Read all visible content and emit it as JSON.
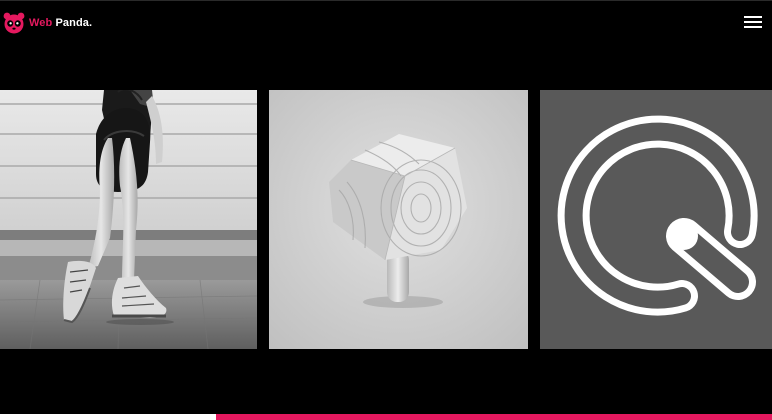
{
  "brand": {
    "name_part1": "Web",
    "name_part2": "Panda.",
    "logo_icon": "panda-icon",
    "accent_color": "#e5195f"
  },
  "header": {
    "menu_icon": "hamburger-menu-icon"
  },
  "gallery": {
    "items": [
      {
        "name": "portfolio-card-fashion",
        "description_icon": "photo"
      },
      {
        "name": "portfolio-card-wooden-object",
        "description_icon": "photo"
      },
      {
        "name": "portfolio-card-q-logo",
        "description_icon": "logo"
      }
    ]
  },
  "progress": {
    "value": 0.72,
    "fill_color": "#e5195f",
    "track_color": "#ffffff"
  }
}
